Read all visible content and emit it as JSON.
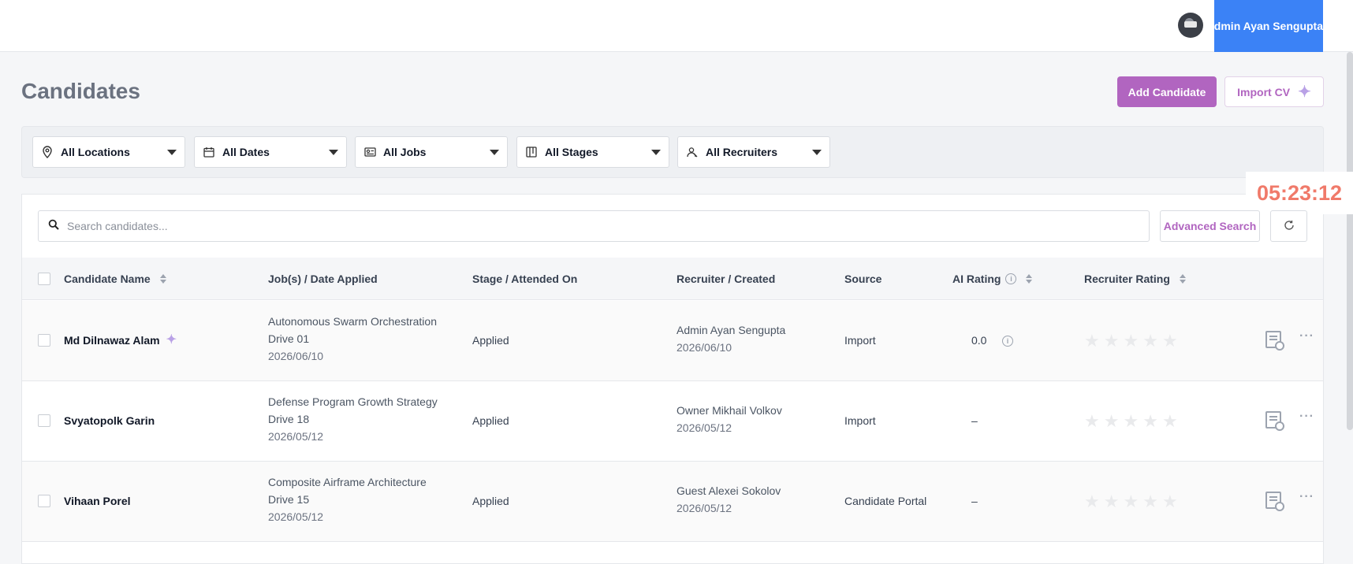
{
  "header": {
    "user_label": "Admin Ayan Sengupta"
  },
  "page": {
    "title": "Candidates",
    "add_candidate": "Add Candidate",
    "import_cv": "Import CV"
  },
  "filters": [
    {
      "label": "All Locations",
      "icon": "location-pin-icon"
    },
    {
      "label": "All Dates",
      "icon": "calendar-icon"
    },
    {
      "label": "All Jobs",
      "icon": "id-card-icon"
    },
    {
      "label": "All Stages",
      "icon": "kanban-icon"
    },
    {
      "label": "All Recruiters",
      "icon": "recruiter-icon"
    }
  ],
  "timer": "05:23:12",
  "search": {
    "placeholder": "Search candidates...",
    "advanced_label": "Advanced Search"
  },
  "table": {
    "headers": {
      "name": "Candidate Name",
      "job": "Job(s) / Date Applied",
      "stage": "Stage / Attended On",
      "recruiter": "Recruiter / Created",
      "source": "Source",
      "ai_rating": "AI Rating",
      "recruiter_rating": "Recruiter Rating"
    },
    "rows": [
      {
        "name": "Md Dilnawaz Alam",
        "job_line1": "Autonomous Swarm Orchestration",
        "job_line2": "Drive 01",
        "job_date": "2026/06/10",
        "stage": "Applied",
        "recruiter": "Admin Ayan Sengupta",
        "created": "2026/06/10",
        "source": "Import",
        "ai_rating": "0.0"
      },
      {
        "name": "Svyatopolk Garin",
        "job_line1": "Defense Program Growth Strategy",
        "job_line2": "Drive 18",
        "job_date": "2026/05/12",
        "stage": "Applied",
        "recruiter": "Owner Mikhail Volkov",
        "created": "2026/05/12",
        "source": "Import",
        "ai_rating": "–"
      },
      {
        "name": "Vihaan Porel",
        "job_line1": "Composite Airframe Architecture",
        "job_line2": "Drive 15",
        "job_date": "2026/05/12",
        "stage": "Applied",
        "recruiter": "Guest Alexei Sokolov",
        "created": "2026/05/12",
        "source": "Candidate Portal",
        "ai_rating": "–"
      }
    ]
  },
  "colors": {
    "accent": "#b165c0",
    "topbar_user": "#3b82f6",
    "timer": "#f07a6a"
  }
}
